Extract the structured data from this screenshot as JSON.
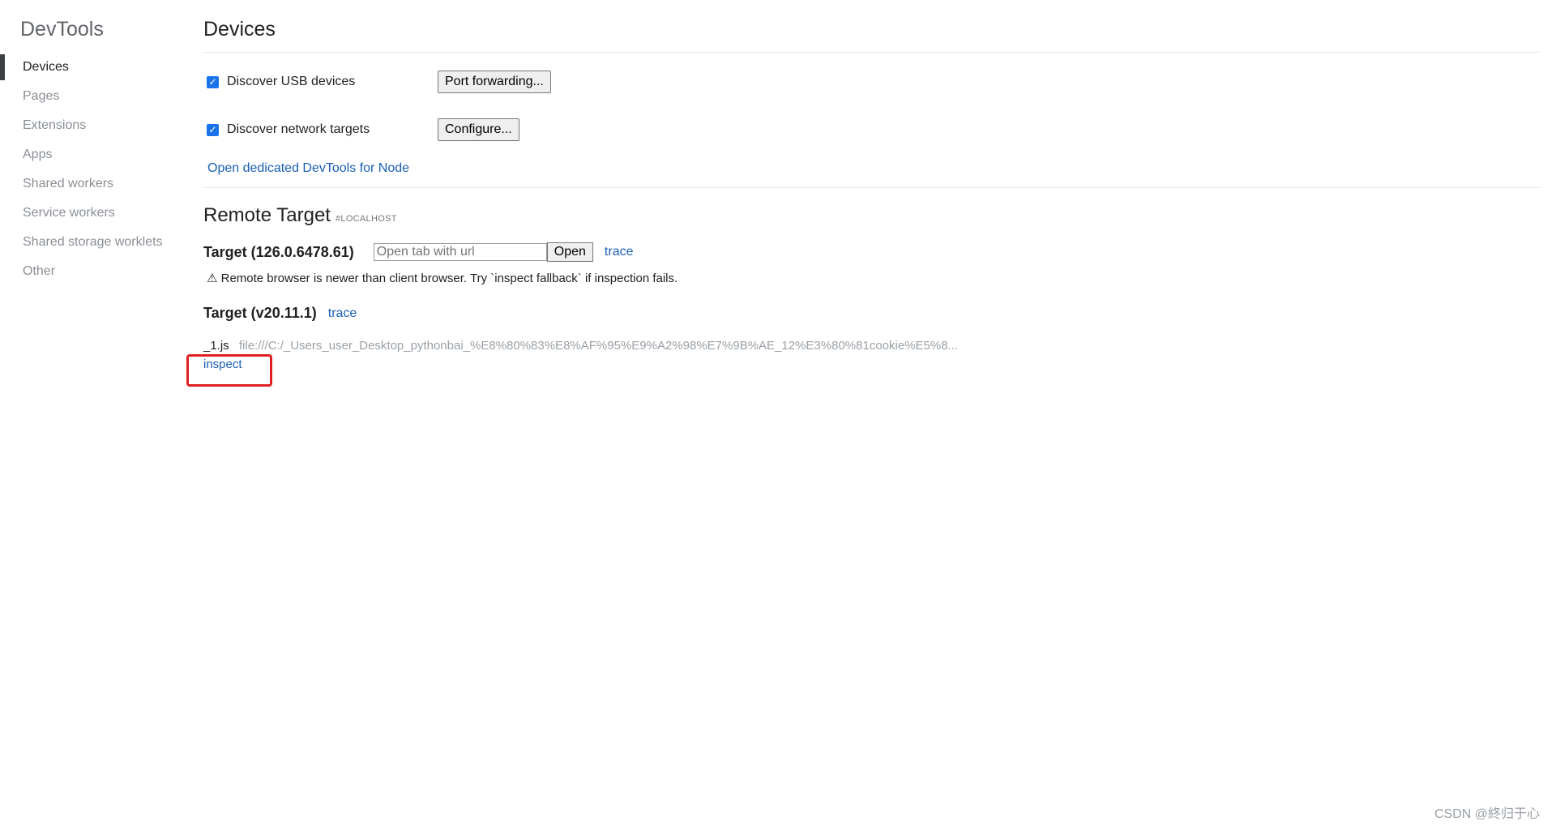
{
  "sidebar": {
    "title": "DevTools",
    "items": [
      {
        "label": "Devices"
      },
      {
        "label": "Pages"
      },
      {
        "label": "Extensions"
      },
      {
        "label": "Apps"
      },
      {
        "label": "Shared workers"
      },
      {
        "label": "Service workers"
      },
      {
        "label": "Shared storage worklets"
      },
      {
        "label": "Other"
      }
    ]
  },
  "main": {
    "title": "Devices",
    "options": {
      "usb": {
        "label": "Discover USB devices",
        "checked": true,
        "button": "Port forwarding..."
      },
      "network": {
        "label": "Discover network targets",
        "checked": true,
        "button": "Configure..."
      }
    },
    "node_link": "Open dedicated DevTools for Node",
    "remote": {
      "title": "Remote Target",
      "subtitle": "#LOCALHOST",
      "targets": [
        {
          "name": "Target (126.0.6478.61)",
          "url_placeholder": "Open tab with url",
          "open_label": "Open",
          "trace_label": "trace",
          "warning": "⚠ Remote browser is newer than client browser. Try `inspect fallback` if inspection fails."
        },
        {
          "name": "Target (v20.11.1)",
          "trace_label": "trace",
          "file_name": "_1.js",
          "file_url": "file:///C:/_Users_user_Desktop_pythonbai_%E8%80%83%E8%AF%95%E9%A2%98%E7%9B%AE_12%E3%80%81cookie%E5%8...",
          "inspect_label": "inspect"
        }
      ]
    }
  },
  "watermark": "CSDN @終归于心",
  "colors": {
    "link": "#1a5fb4",
    "highlight": "#e02020",
    "checkbox": "#1a73e8"
  }
}
